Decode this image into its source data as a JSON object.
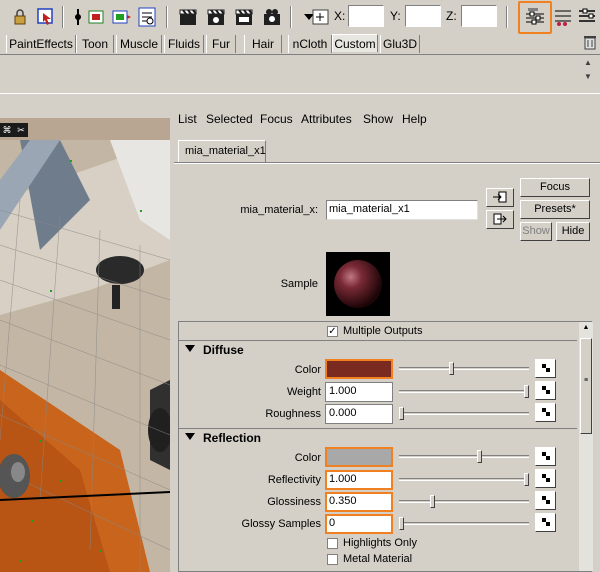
{
  "toolbar": {
    "icons": [
      "lock-icon",
      "select-cursor-icon",
      "snap-icon",
      "render-region-icon",
      "render-frame-icon",
      "render-settings-icon",
      "clapperboard-icon",
      "clapperboard-icon",
      "clapperboard-ipr-icon",
      "render-view-icon",
      "dropdown-icon",
      "input-box-icon",
      "attribute-editor-icon",
      "channel-box-icon",
      "tool-settings-icon"
    ],
    "x_label": "X:",
    "y_label": "Y:",
    "z_label": "Z:",
    "x_value": "",
    "y_value": "",
    "z_value": ""
  },
  "shelf": {
    "tabs": [
      "PaintEffects",
      "Toon",
      "Muscle",
      "Fluids",
      "Fur",
      "Hair",
      "nCloth",
      "Custom",
      "Glu3D"
    ],
    "active_tab": "Custom"
  },
  "attribute_editor": {
    "menu": [
      "List",
      "Selected",
      "Focus",
      "Attributes",
      "Show",
      "Help"
    ],
    "node_tab": "mia_material_x1",
    "node_type_label": "mia_material_x:",
    "node_name": "mia_material_x1",
    "buttons": {
      "focus": "Focus",
      "presets": "Presets*",
      "show": "Show",
      "hide": "Hide"
    },
    "sample_label": "Sample",
    "multiple_outputs_label": "Multiple Outputs",
    "multiple_outputs_checked": true,
    "sections": {
      "diffuse": {
        "title": "Diffuse",
        "color_label": "Color",
        "color_value": "#7a2a1e",
        "color_slider": 0.4,
        "weight_label": "Weight",
        "weight": "1.000",
        "weight_slider": 1.0,
        "roughness_label": "Roughness",
        "roughness": "0.000",
        "roughness_slider": 0.0
      },
      "reflection": {
        "title": "Reflection",
        "color_label": "Color",
        "color_value": "#a8a8a8",
        "color_slider": 0.62,
        "reflectivity_label": "Reflectivity",
        "reflectivity": "1.000",
        "reflectivity_slider": 1.0,
        "glossiness_label": "Glossiness",
        "glossiness": "0.350",
        "glossiness_slider": 0.25,
        "glossy_samples_label": "Glossy Samples",
        "glossy_samples": "0",
        "glossy_samples_slider": 0.0,
        "highlights_only_label": "Highlights Only",
        "highlights_only": false,
        "metal_material_label": "Metal Material",
        "metal_material": false
      }
    }
  },
  "colors": {
    "highlight": "#f08020",
    "panel": "#d4d0c8"
  }
}
